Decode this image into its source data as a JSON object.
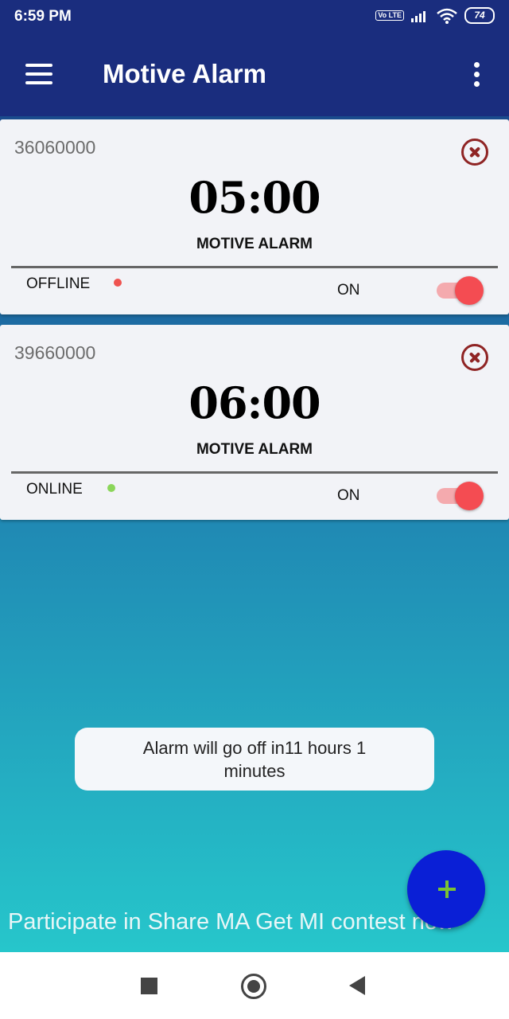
{
  "status_bar": {
    "time": "6:59 PM",
    "volte": "Vo LTE",
    "battery": "74",
    "icons": [
      "volte-icon",
      "signal-icon",
      "wifi-icon",
      "battery-icon"
    ]
  },
  "app_bar": {
    "title": "Motive Alarm",
    "menu_icon": "hamburger-menu-icon",
    "overflow_icon": "more-vert-icon"
  },
  "alarms": [
    {
      "id": "36060000",
      "time": "05:00",
      "label": "MOTIVE ALARM",
      "mode": "OFFLINE",
      "mode_color": "#ef5350",
      "toggle_label": "ON",
      "enabled": true
    },
    {
      "id": "39660000",
      "time": "06:00",
      "label": "MOTIVE ALARM",
      "mode": "ONLINE",
      "mode_color": "#8bd65a",
      "toggle_label": "ON",
      "enabled": true
    }
  ],
  "toast": {
    "message": "Alarm will go off in11 hours 1 minutes"
  },
  "banner": {
    "text": "Participate in Share MA Get MI contest now"
  },
  "fab": {
    "icon": "add-icon"
  },
  "colors": {
    "app_bar": "#1a2d7e",
    "accent": "#f44c52",
    "fab": "#0a1fd6",
    "fab_icon": "#7bc232"
  },
  "nav_bar": {
    "icons": [
      "recents-icon",
      "home-icon",
      "back-icon"
    ]
  }
}
